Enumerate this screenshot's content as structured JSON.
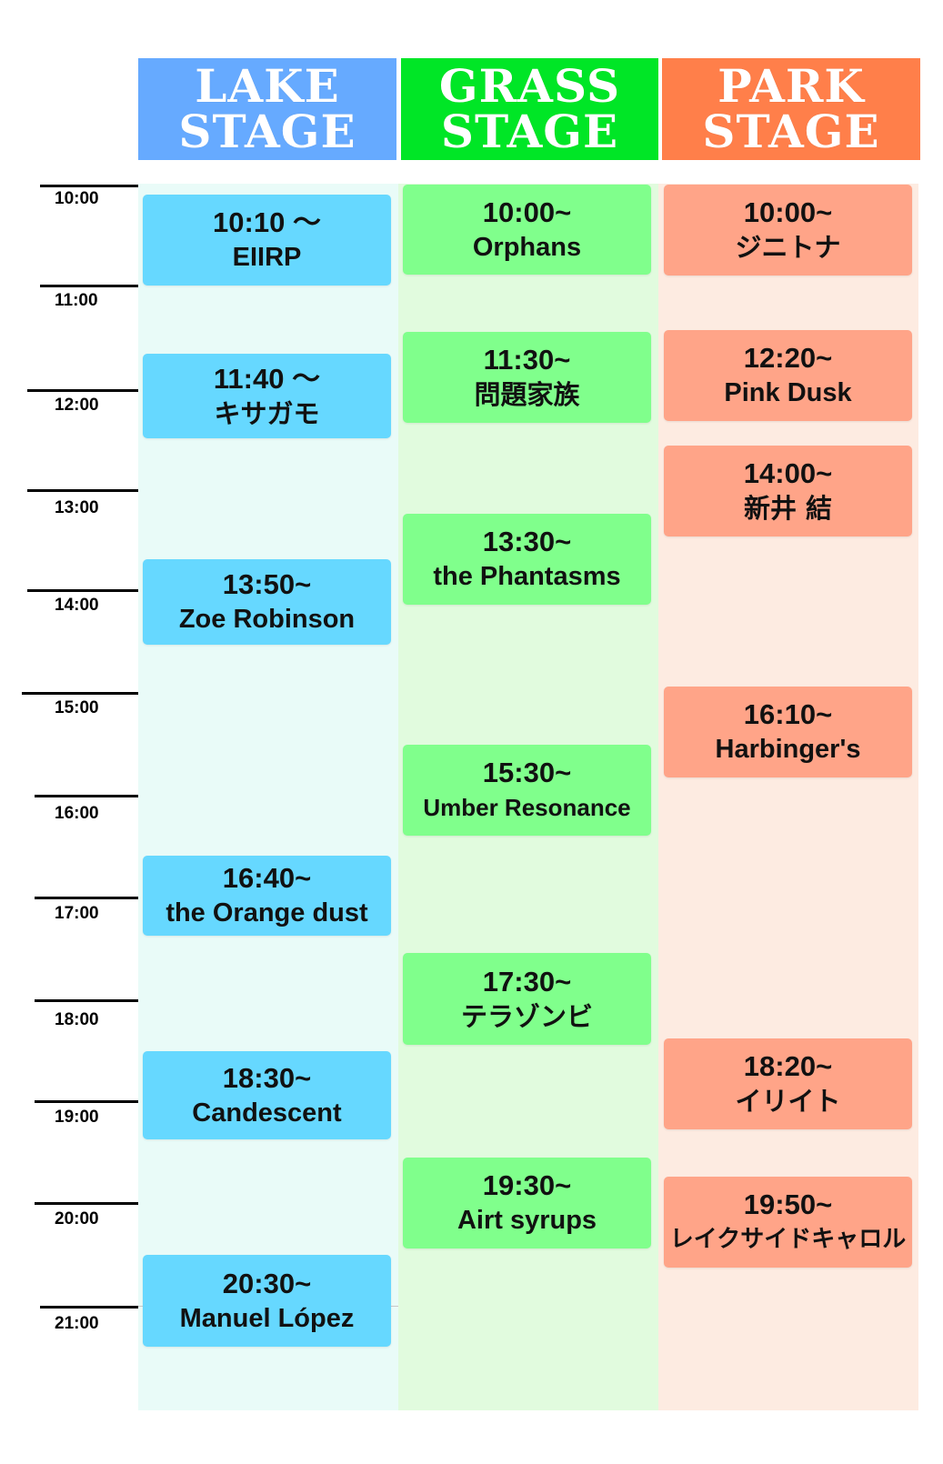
{
  "colors": {
    "lake_header": "#66aaff",
    "grass_header": "#00e626",
    "park_header": "#ff7f4a",
    "lake_lane": "#e9fbf8",
    "grass_lane": "#e1fbde",
    "park_lane": "#fdebe1",
    "lake_slot": "#66d8ff",
    "grass_slot": "#80ff8c",
    "park_slot": "#ffa488"
  },
  "stages": {
    "lake": "LAKE\nSTAGE",
    "grass": "GRASS\nSTAGE",
    "park": "PARK\nSTAGE"
  },
  "times": [
    "10:00",
    "11:00",
    "12:00",
    "13:00",
    "14:00",
    "15:00",
    "16:00",
    "17:00",
    "18:00",
    "19:00",
    "20:00",
    "21:00"
  ],
  "lake": [
    {
      "time": "10:10 ～",
      "artist": "EIIRP"
    },
    {
      "time": "11:40 ～",
      "artist": "キサガモ"
    },
    {
      "time": "13:50~",
      "artist": "Zoe Robinson"
    },
    {
      "time": "16:40~",
      "artist": "the Orange dust"
    },
    {
      "time": "18:30~",
      "artist": "Candescent"
    },
    {
      "time": "20:30~",
      "artist": "Manuel López"
    }
  ],
  "grass": [
    {
      "time": "10:00~",
      "artist": "Orphans"
    },
    {
      "time": "11:30~",
      "artist": "問題家族"
    },
    {
      "time": "13:30~",
      "artist": "the Phantasms"
    },
    {
      "time": "15:30~",
      "artist": "Umber Resonance"
    },
    {
      "time": "17:30~",
      "artist": "テラゾンビ"
    },
    {
      "time": "19:30~",
      "artist": "Airt syrups"
    }
  ],
  "park": [
    {
      "time": "10:00~",
      "artist": "ジニトナ"
    },
    {
      "time": "12:20~",
      "artist": "Pink Dusk"
    },
    {
      "time": "14:00~",
      "artist": "新井 結"
    },
    {
      "time": "16:10~",
      "artist": "Harbinger's"
    },
    {
      "time": "18:20~",
      "artist": "イリイト"
    },
    {
      "time": "19:50~",
      "artist": "レイクサイドキャロル"
    }
  ]
}
